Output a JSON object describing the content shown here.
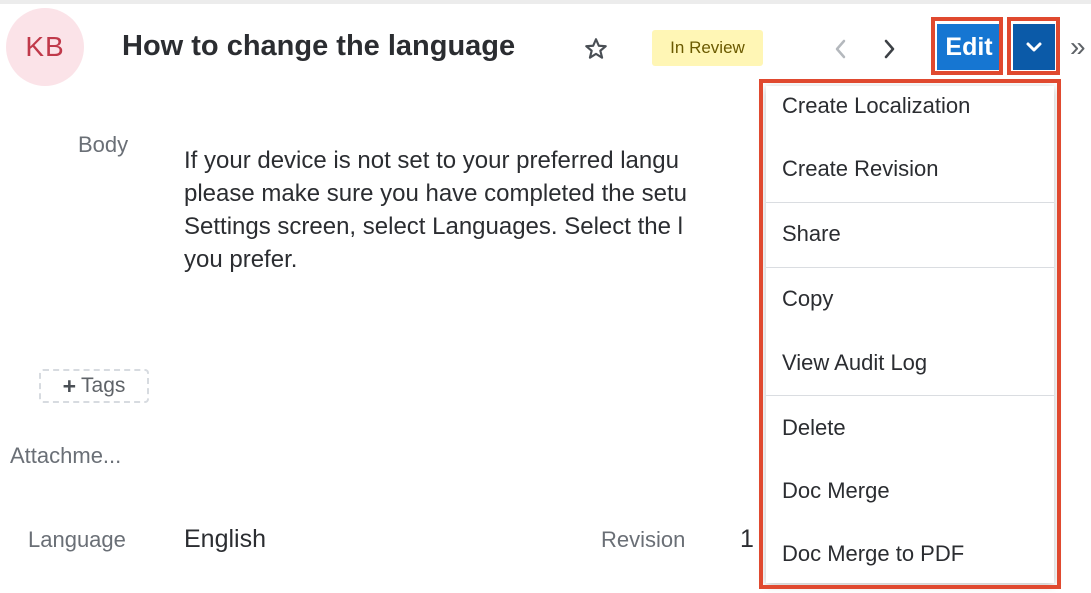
{
  "header": {
    "avatar_initials": "KB",
    "title": "How to change the language",
    "status": "In Review",
    "edit_label": "Edit",
    "overflow_glyph": "»"
  },
  "icons": {
    "favorite": "star-icon",
    "prev": "chevron-left-icon",
    "next": "chevron-right-icon",
    "more": "chevron-down-icon",
    "overflow": "double-chevron-right-icon",
    "add_tag": "plus-icon"
  },
  "fields": {
    "body_label": "Body",
    "body_lines": [
      "If your device is not set to your preferred langu",
      "please make sure you have completed the setu",
      "Settings screen, select Languages. Select the l",
      "you prefer."
    ],
    "tags_label": "Tags",
    "attachments_label": "Attachme...",
    "language_label": "Language",
    "language_value": "English",
    "revision_label": "Revision",
    "revision_value": "1"
  },
  "dropdown": {
    "items": [
      "Create Localization",
      "Create Revision",
      "Share",
      "Copy",
      "View Audit Log",
      "Delete",
      "Doc Merge",
      "Doc Merge to PDF"
    ]
  },
  "colors": {
    "primary": "#1676d2",
    "primary_dark": "#0b5aa8",
    "highlight": "#e0492f",
    "badge_bg": "#fff6b5",
    "avatar_bg": "#fbe3e8",
    "avatar_text": "#c0394a"
  }
}
